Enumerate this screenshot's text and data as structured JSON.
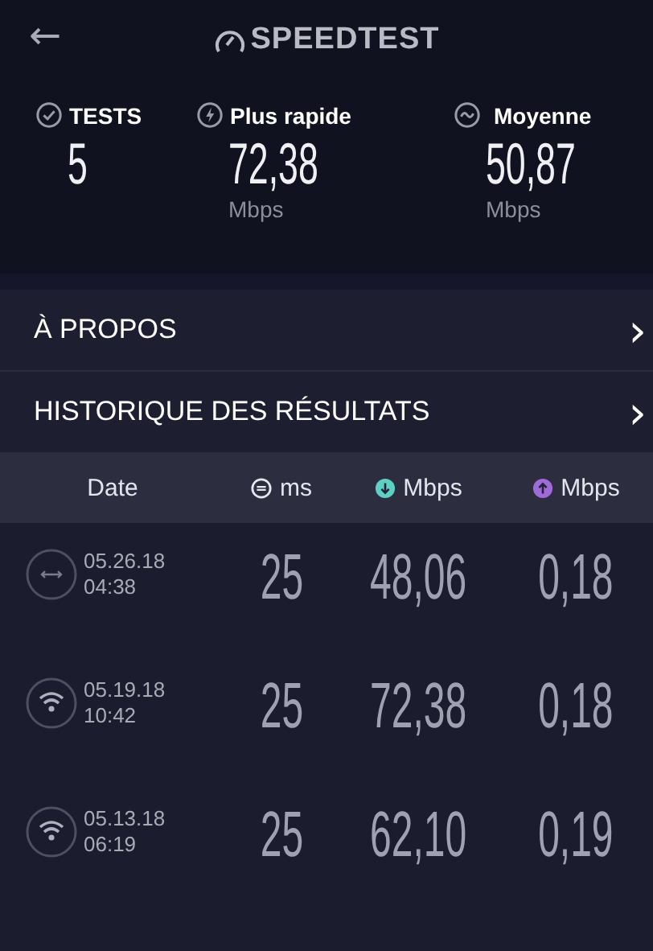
{
  "header": {
    "back": "←",
    "logo": "SPEEDTEST"
  },
  "stats": [
    {
      "kind": "check",
      "label": "TESTS",
      "value": "5"
    },
    {
      "kind": "bolt",
      "label": "Plus rapide",
      "value": "72,38",
      "unit": "Mbps"
    },
    {
      "kind": "wave",
      "label": "Moyenne",
      "value": "50,87",
      "unit": "Mbps"
    }
  ],
  "menu": [
    {
      "label": "À PROPOS",
      "chevron": "›"
    },
    {
      "label": "HISTORIQUE DES RÉSULTATS",
      "chevron": "›"
    }
  ],
  "table": {
    "columns": [
      {
        "kind": "none",
        "label": "Date"
      },
      {
        "kind": "ping",
        "label": "ms"
      },
      {
        "kind": "down",
        "label": "Mbps"
      },
      {
        "kind": "up",
        "label": "Mbps"
      }
    ],
    "rows": [
      {
        "kind": "ethernet",
        "date": "05.26.18",
        "time": "04:38",
        "ping": "25",
        "down": "48,06",
        "up": "0,18"
      },
      {
        "kind": "wifi",
        "date": "05.19.18",
        "time": "10:42",
        "ping": "25",
        "down": "72,38",
        "up": "0,18"
      },
      {
        "kind": "wifi",
        "date": "05.13.18",
        "time": "06:19",
        "ping": "25",
        "down": "62,10",
        "up": "0,19"
      }
    ]
  }
}
